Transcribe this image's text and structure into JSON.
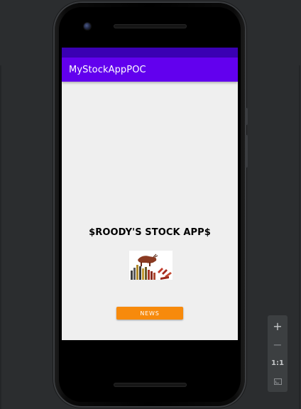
{
  "app": {
    "title": "MyStockAppPOC",
    "headline": "$ROODY'S STOCK APP$",
    "news_button_label": "NEWS",
    "hero_image_icon": "bull-market-icon"
  },
  "colors": {
    "status_bar": "#3a00b3",
    "app_bar": "#6200ee",
    "screen_background": "#efefef",
    "news_button": "#f78a0c"
  },
  "emulator_toolbar": {
    "zoom_in_label": "+",
    "zoom_out_label": "−",
    "actual_size_label": "1:1",
    "fit_icon": "fit-screen-icon"
  }
}
